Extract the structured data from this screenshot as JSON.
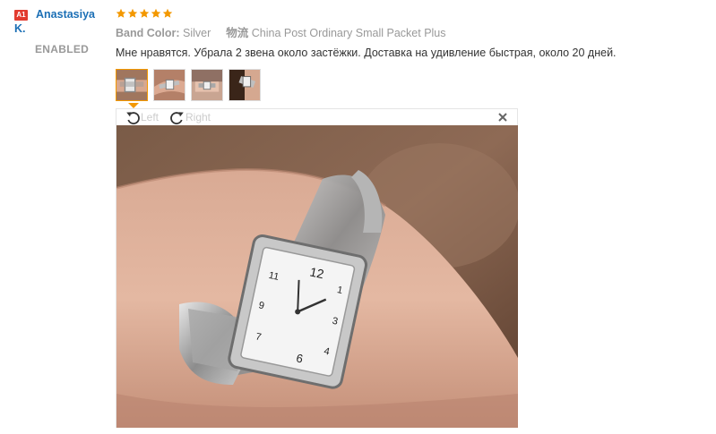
{
  "user": {
    "country_code": "A1",
    "name": "Anastasiya K.",
    "status": "ENABLED"
  },
  "review": {
    "rating": 5,
    "star_color": "#f39800",
    "band_color_label": "Band Color:",
    "band_color_value": "Silver",
    "shipping_label": "物流",
    "shipping_value": "China Post Ordinary Small Packet Plus",
    "text": "Мне нравятся. Убрала 2 звена около застёжки. Доставка на удивление быстрая, около 20 дней."
  },
  "gallery": {
    "thumbnail_count": 4,
    "active_index": 0,
    "rotate_left_label": "Left",
    "rotate_right_label": "Right",
    "close_icon": "close-icon"
  },
  "colors": {
    "link": "#1b6fb5",
    "accent": "#f39800",
    "badge": "#e23b2f"
  }
}
